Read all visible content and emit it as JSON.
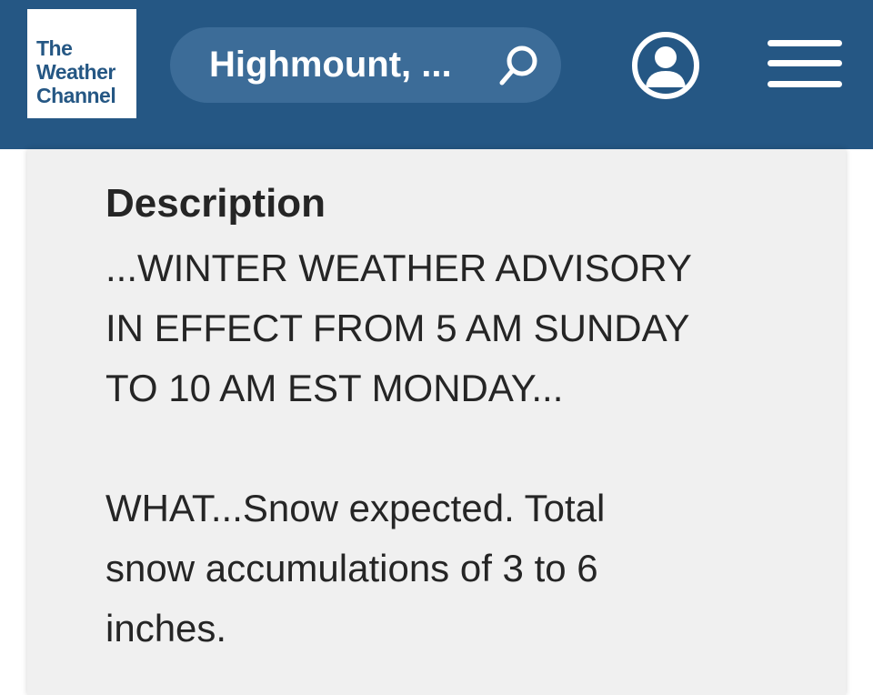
{
  "header": {
    "logo": {
      "line1": "The",
      "line2": "Weather",
      "line3": "Channel"
    },
    "search": {
      "value": "Highmount, ..."
    },
    "icons": {
      "search": "search-icon",
      "account": "account-icon",
      "menu": "hamburger-menu-icon"
    },
    "colors": {
      "background": "#255784",
      "search_background": "#3c6c98"
    }
  },
  "alert": {
    "heading": "Description",
    "paragraphs": [
      [
        "...WINTER WEATHER ADVISORY",
        "IN EFFECT FROM 5 AM SUNDAY",
        "TO 10 AM EST MONDAY..."
      ],
      [
        "WHAT...Snow expected. Total",
        "snow accumulations of 3 to 6",
        "inches."
      ]
    ]
  }
}
